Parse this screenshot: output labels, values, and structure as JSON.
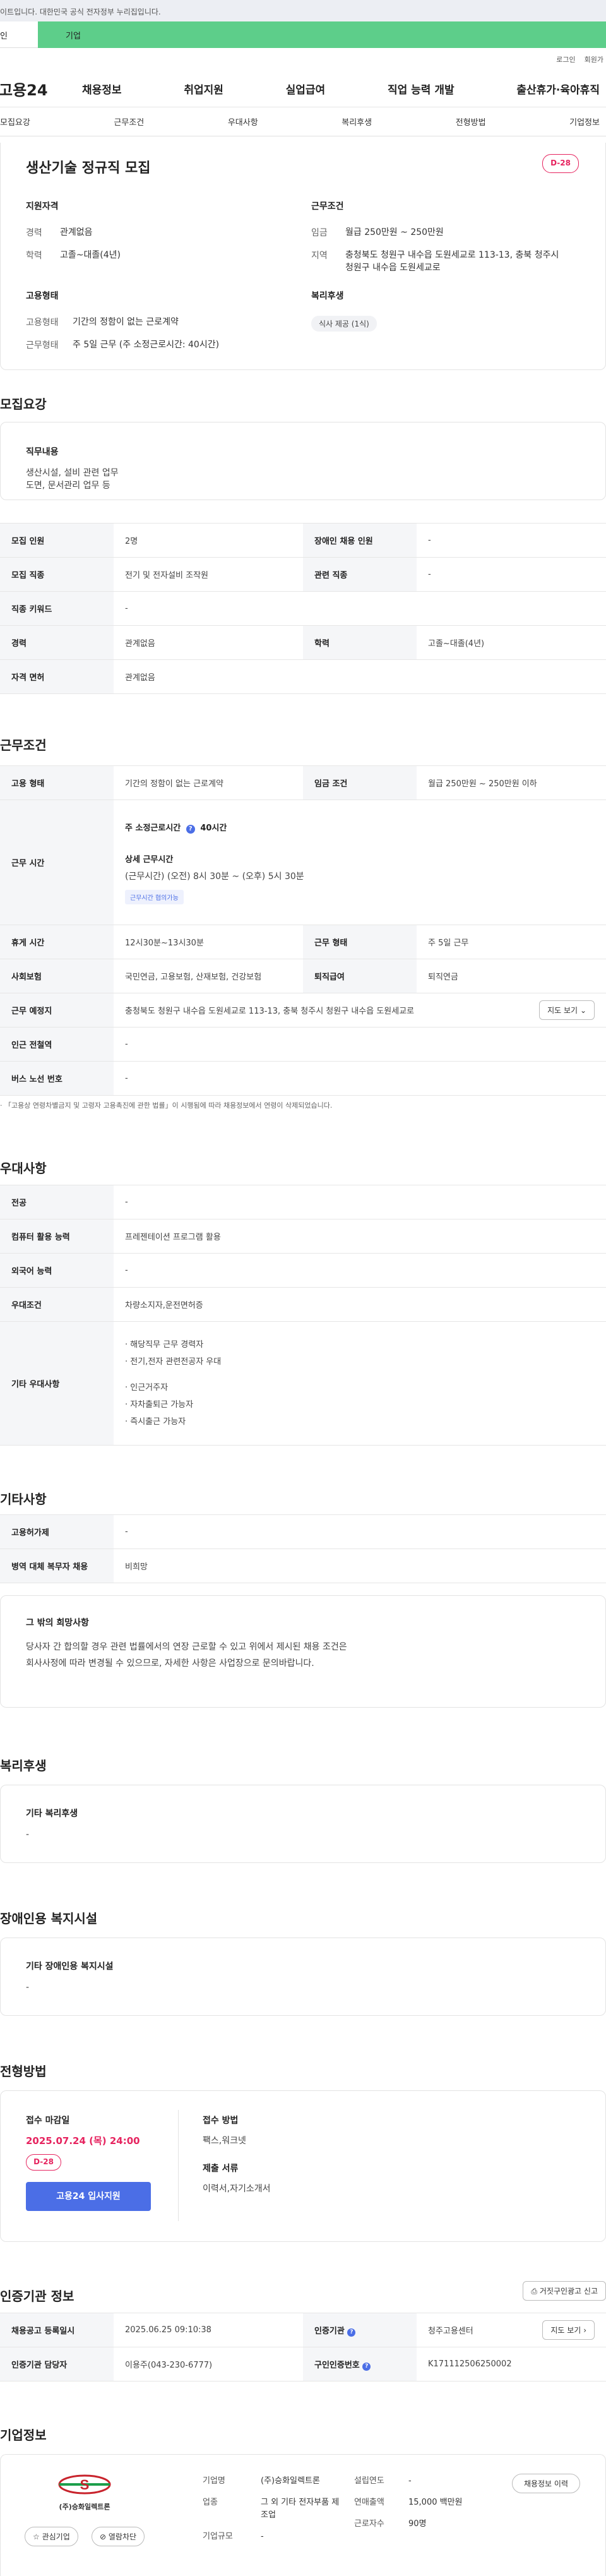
{
  "govbar": "이트입니다. 대한민국 공식 전자정부 누리집입니다.",
  "tabs": {
    "personal": "인",
    "company": "기업"
  },
  "util": {
    "login": "로그인",
    "signup": "회원가"
  },
  "header": {
    "logo": "고용24",
    "menu": [
      "채용정보",
      "취업지원",
      "실업급여",
      "직업 능력 개발",
      "출산휴가·육아휴직"
    ]
  },
  "subnav": [
    "모집요강",
    "근무조건",
    "우대사항",
    "복리후생",
    "전형방법",
    "기업정보"
  ],
  "summary": {
    "title": "생산기술 정규직 모집",
    "dday": "D-28",
    "qual_title": "지원자격",
    "career_label": "경력",
    "career": "관계없음",
    "edu_label": "학력",
    "edu": "고졸~대졸(4년)",
    "work_title": "근무조건",
    "wage_label": "임금",
    "wage": "월급 250만원 ~ 250만원",
    "area_label": "지역",
    "area": "충청북도 청원구 내수읍 도원세교로 113-13, 충북 청주시 청원구 내수읍 도원세교로",
    "emp_title": "고용형태",
    "emptype_label": "고용형태",
    "emptype": "기간의 정함이 없는 근로계약",
    "worktype_label": "근무형태",
    "worktype": "주 5일 근무 (주 소정근로시간: 40시간)",
    "welfare_title": "복리후생",
    "welfare_chip": "식사 제공 (1식)"
  },
  "recruit": {
    "title": "모집요강",
    "duty_title": "직무내용",
    "duty_text": "생산시설, 설비 관련 업무\n도면, 문서관리 업무 등",
    "rows": [
      {
        "h1": "모집 인원",
        "v1": "2명",
        "h2": "장애인 채용 인원",
        "v2": "-"
      },
      {
        "h1": "모집 직종",
        "v1": "전기 및 전자설비 조작원",
        "h2": "관련 직종",
        "v2": "-"
      },
      {
        "h1": "직종 키워드",
        "v1": "-"
      },
      {
        "h1": "경력",
        "v1": "관계없음",
        "h2": "학력",
        "v2": "고졸~대졸(4년)"
      },
      {
        "h1": "자격 면허",
        "v1": "관계없음"
      }
    ]
  },
  "conditions": {
    "title": "근무조건",
    "emptype_h": "고용 형태",
    "emptype": "기간의 정함이 없는 근로계약",
    "wage_h": "임금 조건",
    "wage": "월급 250만원 ~ 250만원 이하",
    "worktime_h": "근무 시간",
    "weekly": "주 소정근로시간",
    "weekly_val": "40시간",
    "detail_title": "상세 근무시간",
    "detail_text": "(근무시간) (오전) 8시 30분 ~ (오후) 5시 30분",
    "flex_tag": "근무시간 협의가능",
    "break_h": "휴게 시간",
    "break": "12시30분~13시30분",
    "shift_h": "근무 형태",
    "shift": "주 5일 근무",
    "insurance_h": "사회보험",
    "insurance": "국민연금, 고용보험, 산재보험, 건강보험",
    "retire_h": "퇴직급여",
    "retire": "퇴직연금",
    "place_h": "근무 예정지",
    "place": "충청북도 청원구 내수읍 도원세교로 113-13, 충북 청주시 청원구 내수읍 도원세교로",
    "map_btn": "지도 보기",
    "station_h": "인근 전철역",
    "station": "-",
    "bus_h": "버스 노선 번호",
    "bus": "-",
    "note": "「고용상 연령차별금지 및 고령자 고용촉진에 관한 법률」이 시행됨에 따라 채용정보에서 연령이 삭제되었습니다."
  },
  "preference": {
    "title": "우대사항",
    "major_h": "전공",
    "major": "-",
    "pc_h": "컴퓨터 활용 능력",
    "pc": "프레젠테이션 프로그램 활용",
    "lang_h": "외국어 능력",
    "lang": "-",
    "cond_h": "우대조건",
    "cond": "차량소지자,운전면허증",
    "etc_h": "기타 우대사항",
    "etc_items": [
      "· 해당직무 근무 경력자",
      "· 전기,전자 관련전공자 우대",
      "· 인근거주자",
      "· 자차출퇴근 가능자",
      "· 즉시출근 가능자"
    ]
  },
  "other": {
    "title": "기타사항",
    "permit_h": "고용허가제",
    "permit": "-",
    "army_h": "병역 대체 복무자 채용",
    "army": "비희망",
    "hope_title": "그 밖의 희망사항",
    "hope_text": "당사자 간 합의할 경우 관련 법률에서의 연장 근로할 수 있고 위에서 제시된 채용 조건은 회사사정에 따라 변경될 수 있으므로, 자세한 사항은 사업장으로 문의바랍니다."
  },
  "welfare": {
    "title": "복리후생",
    "box_title": "기타 복리후생",
    "box_value": "-"
  },
  "disabled": {
    "title": "장애인용 복지시설",
    "box_title": "기타 장애인용 복지시설",
    "box_value": "-"
  },
  "selection": {
    "title": "전형방법",
    "deadline_title": "접수 마감일",
    "deadline": "2025.07.24 (목) 24:00",
    "dday": "D-28",
    "apply_btn": "고용24 입사지원",
    "method_title": "접수 방법",
    "method": "팩스,워크넷",
    "docs_title": "제출 서류",
    "docs": "이력서,자기소개서"
  },
  "agency": {
    "title": "인증기관 정보",
    "report_btn": "거짓구인광고 신고",
    "reg_h": "채용공고 등록일시",
    "reg": "2025.06.25 09:10:38",
    "org_h": "인증기관",
    "org": "청주고용센터",
    "map_btn": "지도 보기",
    "mgr_h": "인증기관 담당자",
    "mgr": "이용주(043-230-6777)",
    "num_h": "구인인증번호",
    "num": "K171112506250002"
  },
  "company": {
    "title": "기업정보",
    "logo_text": "(주)승화일렉트론",
    "fav_btn": "관심기업",
    "block_btn": "열람차단",
    "name_h": "기업명",
    "name": "(주)승화일렉트론",
    "industry_h": "업종",
    "industry": "그 외 기타 전자부품 제조업",
    "size_h": "기업규모",
    "size": "-",
    "founded_h": "설립연도",
    "founded": "-",
    "sales_h": "연매출액",
    "sales": "15,000 백만원",
    "workers_h": "근로자수",
    "workers": "90명",
    "jobs_btn": "채용정보 이력"
  },
  "colors": {
    "accent": "#4b6ee6",
    "green": "#5dce8a",
    "dday": "#e6245f"
  }
}
